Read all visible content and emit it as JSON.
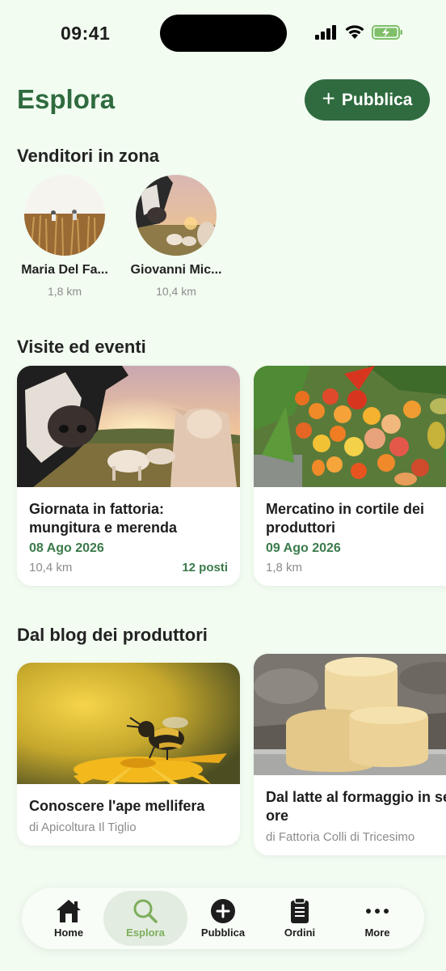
{
  "status": {
    "time": "09:41"
  },
  "header": {
    "title": "Esplora",
    "publish_label": "Pubblica"
  },
  "sections": {
    "sellers": "Venditori in zona",
    "events": "Visite ed eventi",
    "blog": "Dal blog dei produttori"
  },
  "sellers": [
    {
      "name": "Maria Del Fa...",
      "distance": "1,8 km"
    },
    {
      "name": "Giovanni Mic...",
      "distance": "10,4 km"
    }
  ],
  "events": [
    {
      "title": "Giornata in fattoria: mungitura e merenda",
      "date": "08 Ago 2026",
      "distance": "10,4 km",
      "seats": "12 posti"
    },
    {
      "title": "Mercatino in cortile dei produttori",
      "date": "09 Ago 2026",
      "distance": "1,8 km",
      "seats": ""
    }
  ],
  "blog": [
    {
      "title": "Conoscere l'ape mellifera",
      "author": "di Apicoltura Il Tiglio"
    },
    {
      "title": "Dal latte al formaggio in sei ore",
      "author": "di Fattoria Colli di Tricesimo"
    }
  ],
  "tabs": [
    {
      "label": "Home",
      "icon": "home-icon"
    },
    {
      "label": "Esplora",
      "icon": "search-icon",
      "active": true
    },
    {
      "label": "Pubblica",
      "icon": "plus-circle-icon"
    },
    {
      "label": "Ordini",
      "icon": "clipboard-icon"
    },
    {
      "label": "More",
      "icon": "more-icon"
    }
  ],
  "colors": {
    "accent": "#2f6b3f",
    "active_tab": "#7cae5c",
    "background": "#f2fcf1"
  }
}
